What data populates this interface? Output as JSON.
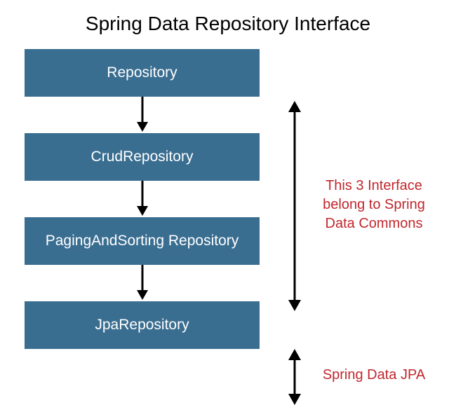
{
  "title": "Spring Data Repository Interface",
  "boxes": {
    "repository": "Repository",
    "crud": "CrudRepository",
    "paging": "PagingAndSorting Repository",
    "jpa": "JpaRepository"
  },
  "annotations": {
    "commons": "This 3 Interface belong to Spring Data Commons",
    "jpa": "Spring Data JPA"
  },
  "colors": {
    "box_bg": "#3a6e91",
    "box_text": "#ffffff",
    "annotation_text": "#c1272d",
    "arrow": "#000000"
  }
}
